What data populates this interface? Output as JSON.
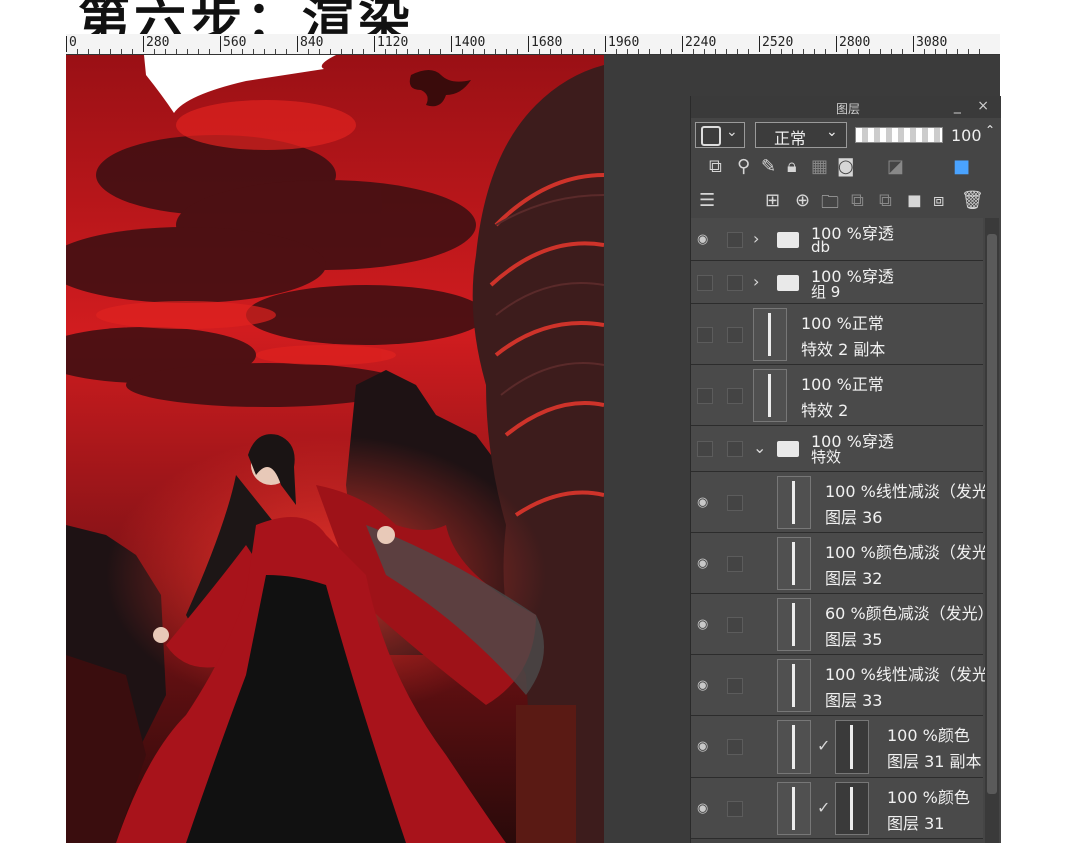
{
  "heading": "第六步：渲染",
  "ruler": {
    "labels": [
      "0",
      "280",
      "560",
      "840",
      "1120",
      "1400",
      "1680",
      "1960",
      "2240",
      "2520",
      "2800",
      "3080"
    ]
  },
  "layer_panel": {
    "title": "图层",
    "window_controls": "_ ×",
    "blend_mode": "正常",
    "opacity": "100",
    "layers": [
      {
        "opacity": "100",
        "mode": "%穿透",
        "name": "db",
        "type": "folder",
        "expanded": false,
        "visible": true
      },
      {
        "opacity": "100",
        "mode": "%穿透",
        "name": "组 9",
        "type": "folder",
        "expanded": false,
        "visible": false
      },
      {
        "opacity": "100",
        "mode": "%正常",
        "name": "特效 2 副本",
        "type": "layer",
        "visible": false
      },
      {
        "opacity": "100",
        "mode": "%正常",
        "name": "特效 2",
        "type": "layer",
        "visible": false
      },
      {
        "opacity": "100",
        "mode": "%穿透",
        "name": "特效",
        "type": "folder",
        "expanded": true,
        "visible": false
      },
      {
        "opacity": "100",
        "mode": "%线性减淡（发光",
        "name": "图层 36",
        "type": "layer",
        "visible": true
      },
      {
        "opacity": "100",
        "mode": "%颜色减淡（发光",
        "name": "图层 32",
        "type": "layer",
        "visible": true
      },
      {
        "opacity": "60",
        "mode": "%颜色减淡（发光）",
        "name": "图层 35",
        "type": "layer",
        "visible": true
      },
      {
        "opacity": "100",
        "mode": "%线性减淡（发光",
        "name": "图层 33",
        "type": "layer",
        "visible": true
      },
      {
        "opacity": "100",
        "mode": "%颜色",
        "name": "图层 31 副本",
        "type": "masked",
        "visible": true
      },
      {
        "opacity": "100",
        "mode": "%颜色",
        "name": "图层 31",
        "type": "masked",
        "visible": true
      }
    ]
  },
  "colors": {
    "panel_bg": "#454545",
    "sky_red": "#c2141a",
    "robe_red": "#a8131b"
  }
}
